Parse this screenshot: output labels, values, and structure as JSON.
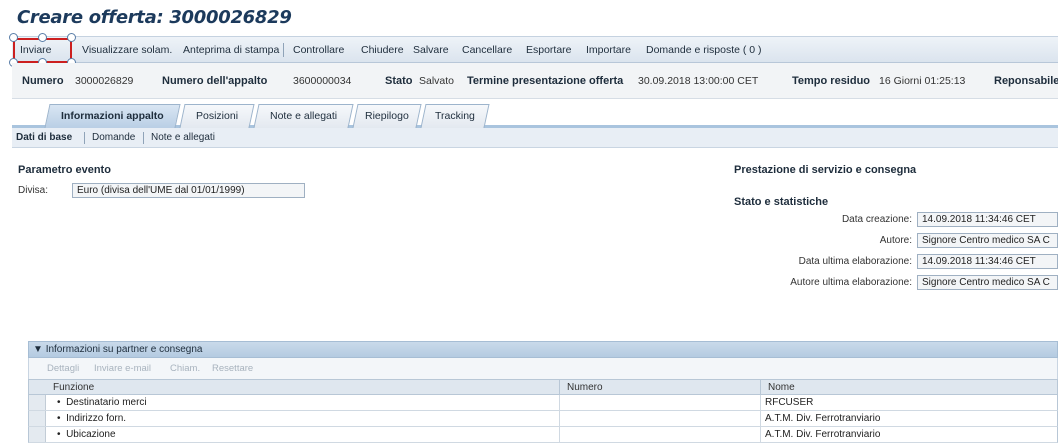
{
  "window": {
    "title": "Creare offerta: 3000026829"
  },
  "toolbar": {
    "items": [
      "Inviare",
      "Visualizzare solam.",
      "Anteprima di stampa",
      "Controllare",
      "Chiudere",
      "Salvare",
      "Cancellare",
      "Esportare",
      "Importare",
      "Domande e risposte ( 0 )"
    ],
    "selected": "Inviare",
    "highlight_color": "#cc1f1f"
  },
  "header": {
    "numero_label": "Numero",
    "numero_value": "3000026829",
    "appalto_label": "Numero dell'appalto",
    "appalto_value": "3600000034",
    "stato_label": "Stato",
    "stato_value": "Salvato",
    "termine_label": "Termine presentazione offerta",
    "termine_value": "30.09.2018 13:00:00 CET",
    "tempo_label": "Tempo residuo",
    "tempo_value": "16 Giorni 01:25:13",
    "responsabile_label": "Reponsabile"
  },
  "tabs": [
    "Informazioni appalto",
    "Posizioni",
    "Note e allegati",
    "Riepilogo",
    "Tracking"
  ],
  "active_tab": "Informazioni appalto",
  "subtabs": [
    "Dati di base",
    "Domande",
    "Note e allegati"
  ],
  "active_subtab": "Dati di base",
  "parametro": {
    "title": "Parametro evento",
    "divisa_label": "Divisa:",
    "divisa_value": "Euro (divisa dell'UME dal 01/01/1999)"
  },
  "prestazione": {
    "title": "Prestazione di servizio e consegna"
  },
  "stato_statistiche": {
    "title": "Stato e statistiche",
    "data_creazione_label": "Data creazione:",
    "data_creazione_value": "14.09.2018 11:34:46 CET",
    "autore_label": "Autore:",
    "autore_value": "Signore Centro medico SA C",
    "data_ultima_label": "Data ultima elaborazione:",
    "data_ultima_value": "14.09.2018 11:34:46 CET",
    "autore_ultima_label": "Autore ultima elaborazione:",
    "autore_ultima_value": "Signore Centro medico SA C"
  },
  "partner": {
    "title": "Informazioni su partner e consegna",
    "tools": [
      "Dettagli",
      "Inviare e-mail",
      "Chiam.",
      "Resettare"
    ],
    "columns": [
      "Funzione",
      "Numero",
      "Nome"
    ],
    "rows": [
      {
        "funzione": "Destinatario merci",
        "numero": "",
        "nome": "RFCUSER"
      },
      {
        "funzione": "Indirizzo forn.",
        "numero": "",
        "nome": "A.T.M. Div. Ferrotranviario"
      },
      {
        "funzione": "Ubicazione",
        "numero": "",
        "nome": "A.T.M. Div. Ferrotranviario"
      }
    ]
  }
}
